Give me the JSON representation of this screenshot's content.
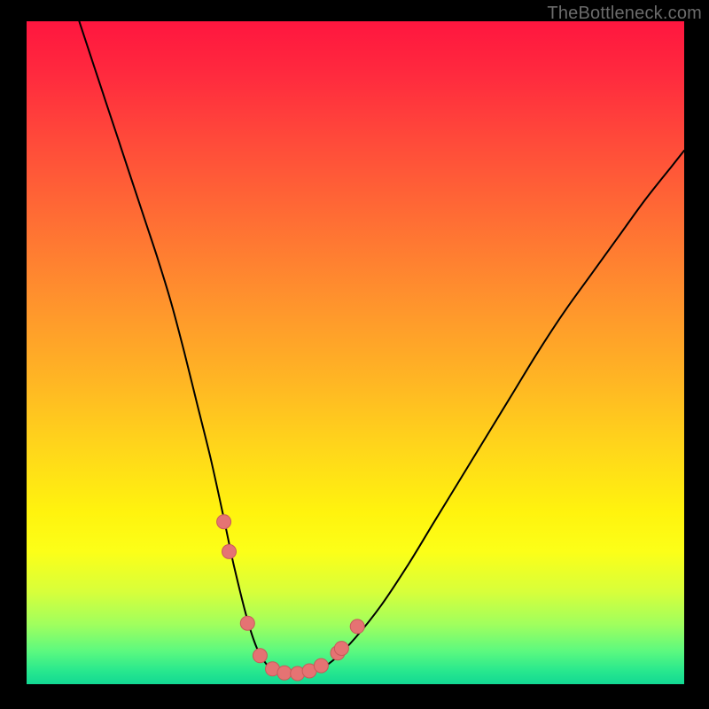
{
  "watermark": "TheBottleneck.com",
  "colors": {
    "page_bg": "#000000",
    "curve_stroke": "#000000",
    "dot_fill": "#e57373",
    "dot_stroke": "#c85a5a",
    "gradient_stops": [
      "#ff163f",
      "#ff2a3e",
      "#ff4a3a",
      "#ff6e34",
      "#ff922d",
      "#ffb524",
      "#ffd81a",
      "#fff30e",
      "#fcff18",
      "#d8ff3a",
      "#a0ff5e",
      "#5cf97f",
      "#28e88e",
      "#12d893"
    ]
  },
  "chart_data": {
    "type": "line",
    "title": "",
    "xlabel": "",
    "ylabel": "",
    "xlim": [
      0,
      100
    ],
    "ylim": [
      0,
      100
    ],
    "grid": false,
    "legend": false,
    "series": [
      {
        "name": "bottleneck-curve",
        "x": [
          8,
          10,
          12,
          14,
          16,
          18,
          20,
          22,
          24,
          26,
          28,
          30,
          31.5,
          33.5,
          35,
          36.5,
          38,
          40,
          42,
          44,
          46.5,
          50,
          54,
          58,
          62,
          66,
          70,
          74,
          78,
          82,
          86,
          90,
          94,
          98,
          100
        ],
        "values": [
          100,
          94,
          88,
          82,
          76,
          70,
          64,
          57.5,
          50,
          42,
          34,
          25,
          18,
          10,
          5.5,
          3,
          2,
          1.5,
          1.5,
          2,
          3.5,
          7,
          12,
          18,
          24.5,
          31,
          37.5,
          44,
          50.5,
          56.5,
          62,
          67.5,
          73,
          78,
          80.5
        ]
      }
    ],
    "markers": [
      {
        "x": 30.0,
        "y": 24.5
      },
      {
        "x": 30.8,
        "y": 20.0
      },
      {
        "x": 33.6,
        "y": 9.2
      },
      {
        "x": 35.5,
        "y": 4.3
      },
      {
        "x": 37.4,
        "y": 2.3
      },
      {
        "x": 39.2,
        "y": 1.7
      },
      {
        "x": 41.2,
        "y": 1.6
      },
      {
        "x": 43.0,
        "y": 2.0
      },
      {
        "x": 44.8,
        "y": 2.8
      },
      {
        "x": 47.3,
        "y": 4.7
      },
      {
        "x": 47.9,
        "y": 5.4
      },
      {
        "x": 50.3,
        "y": 8.7
      }
    ]
  }
}
